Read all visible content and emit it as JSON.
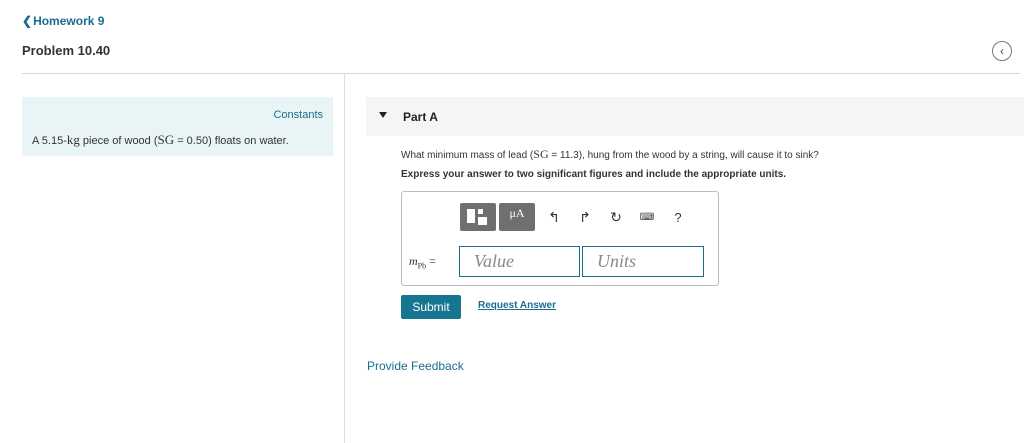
{
  "nav": {
    "back_chevron": "❮",
    "back_label": "Homework 9"
  },
  "problem": {
    "title": "Problem 10.40",
    "collapse_icon": "chevron-left-circle-icon"
  },
  "constants": {
    "link_label": "Constants",
    "text_prefix": "A 5.15-",
    "text_unit": "kg",
    "text_mid": " piece of wood (",
    "text_sg": "SG",
    "text_suffix": " = 0.50) floats on water."
  },
  "part": {
    "title": "Part A",
    "question_prefix": "What minimum mass of lead (",
    "question_sg": "SG",
    "question_suffix": " = 11.3), hung from the wood by a string, will cause it to sink?",
    "instruction": "Express your answer to two significant figures and include the appropriate units."
  },
  "toolbar": {
    "units_button": "μA",
    "undo_icon": "↰",
    "redo_icon": "↱",
    "reset_icon": "↻",
    "keyboard_icon": "⌨",
    "help_icon": "?"
  },
  "answer": {
    "symbol": "m",
    "subscript": "Pb",
    "equals": "=",
    "value_placeholder": "Value",
    "units_placeholder": "Units"
  },
  "actions": {
    "submit_label": "Submit",
    "request_answer_label": "Request Answer",
    "feedback_label": "Provide Feedback"
  },
  "colors": {
    "link": "#1b6d8d",
    "submit_bg": "#17768f",
    "constants_bg": "#e9f4f6",
    "toolbar_bg": "#6f6f6f"
  }
}
